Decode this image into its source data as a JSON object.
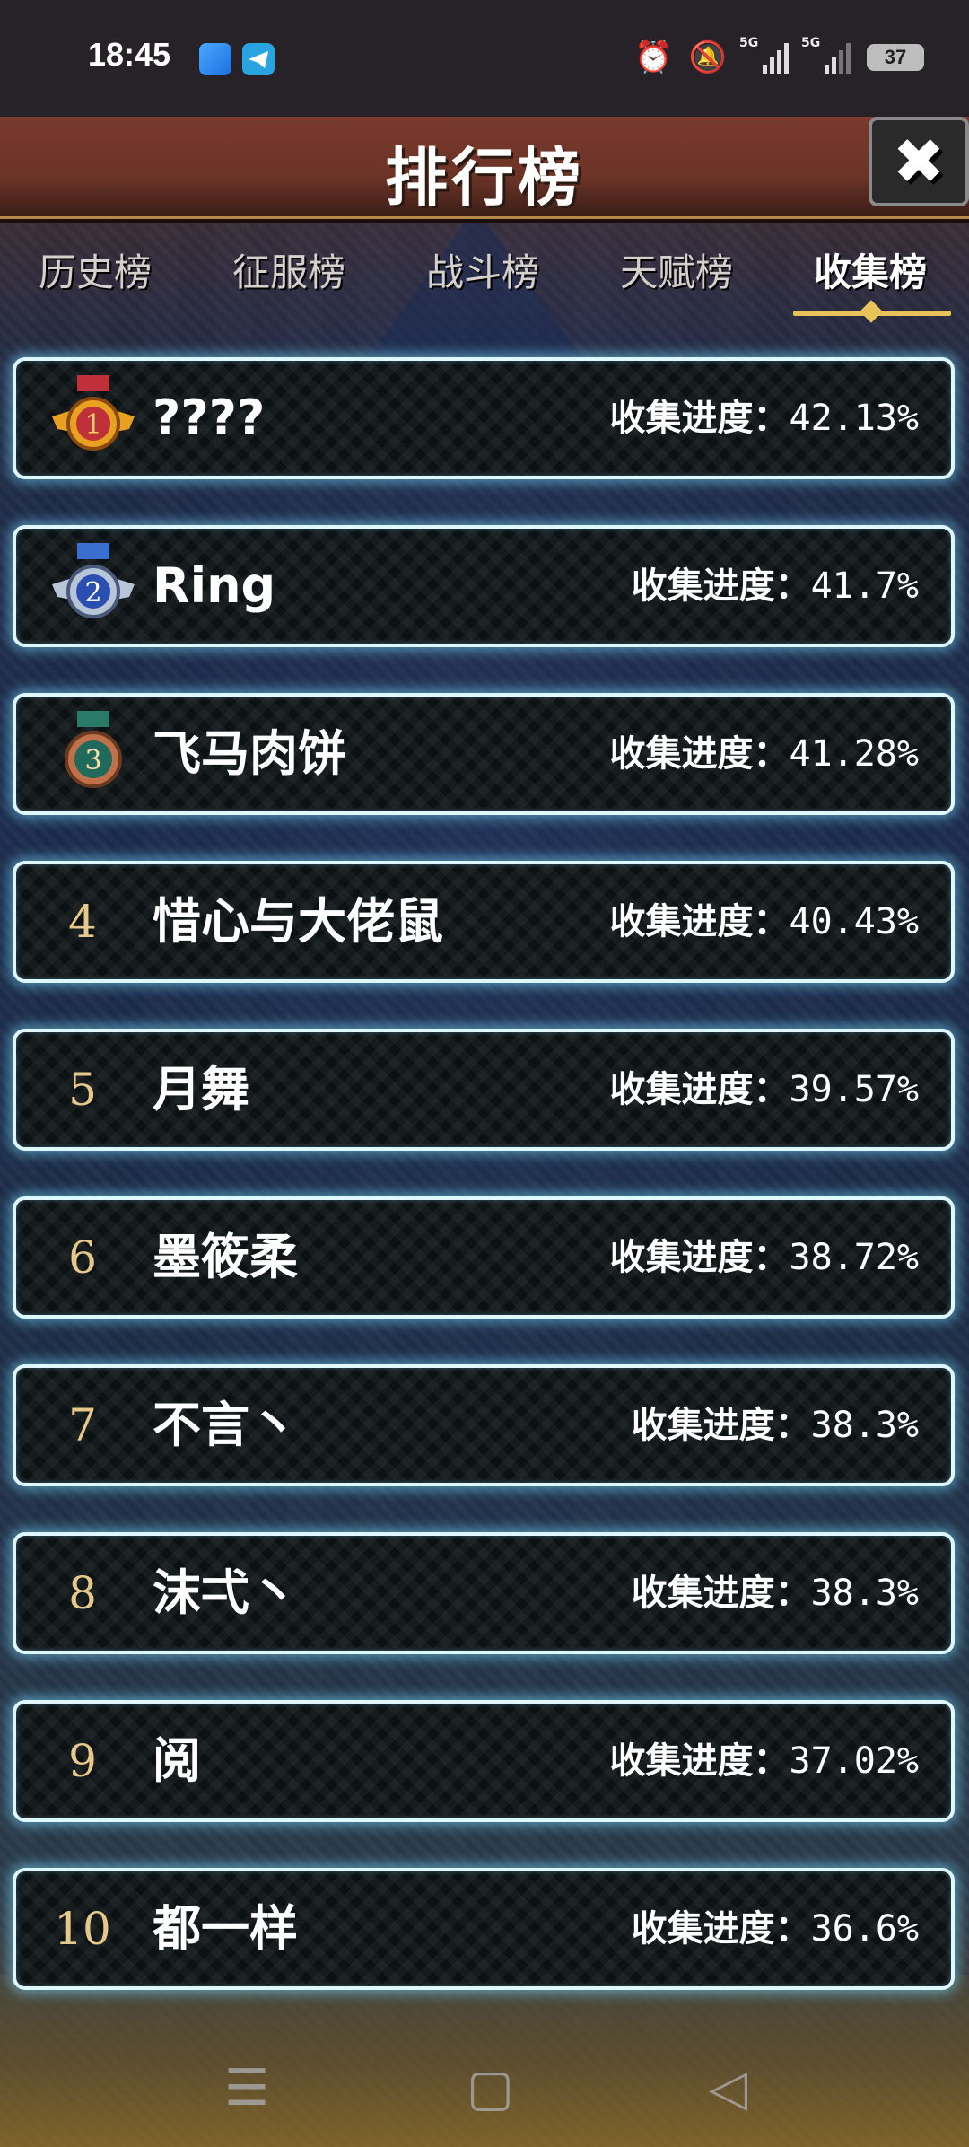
{
  "status_bar": {
    "time": "18:45",
    "battery": "37",
    "network_1": "5G",
    "network_2": "5G",
    "icons": [
      "alarm-icon",
      "bell-muted-icon",
      "signal-icon",
      "signal-icon",
      "battery-icon"
    ]
  },
  "header": {
    "title": "排行榜",
    "close_icon": "close-icon"
  },
  "tabs": [
    {
      "label": "历史榜",
      "active": false
    },
    {
      "label": "征服榜",
      "active": false
    },
    {
      "label": "战斗榜",
      "active": false
    },
    {
      "label": "天赋榜",
      "active": false
    },
    {
      "label": "收集榜",
      "active": true
    }
  ],
  "leaderboard": {
    "progress_label": "收集进度：",
    "rows": [
      {
        "rank": "1",
        "name": "????",
        "progress": "42.13%",
        "medal": "gold"
      },
      {
        "rank": "2",
        "name": "Ring",
        "progress": "41.7%",
        "medal": "silver"
      },
      {
        "rank": "3",
        "name": "飞马肉饼",
        "progress": "41.28%",
        "medal": "bronze"
      },
      {
        "rank": "4",
        "name": "惜心与大佬鼠",
        "progress": "40.43%",
        "medal": ""
      },
      {
        "rank": "5",
        "name": "月舞",
        "progress": "39.57%",
        "medal": ""
      },
      {
        "rank": "6",
        "name": "墨筱柔",
        "progress": "38.72%",
        "medal": ""
      },
      {
        "rank": "7",
        "name": "不言丶",
        "progress": "38.3%",
        "medal": ""
      },
      {
        "rank": "8",
        "name": "沫弌丶",
        "progress": "38.3%",
        "medal": ""
      },
      {
        "rank": "9",
        "name": "阅",
        "progress": "37.02%",
        "medal": ""
      },
      {
        "rank": "10",
        "name": "都一样",
        "progress": "36.6%",
        "medal": ""
      }
    ]
  },
  "colors": {
    "row_glow": "#78dcff",
    "tab_accent": "#e8c35a",
    "rank_number": "#e6c98a",
    "gold_medal": "#e8a020",
    "silver_medal": "#3a6fd0",
    "bronze_medal": "#c0704a"
  },
  "nav_bar": {
    "icons": [
      "menu-icon",
      "home-icon",
      "back-icon"
    ]
  }
}
